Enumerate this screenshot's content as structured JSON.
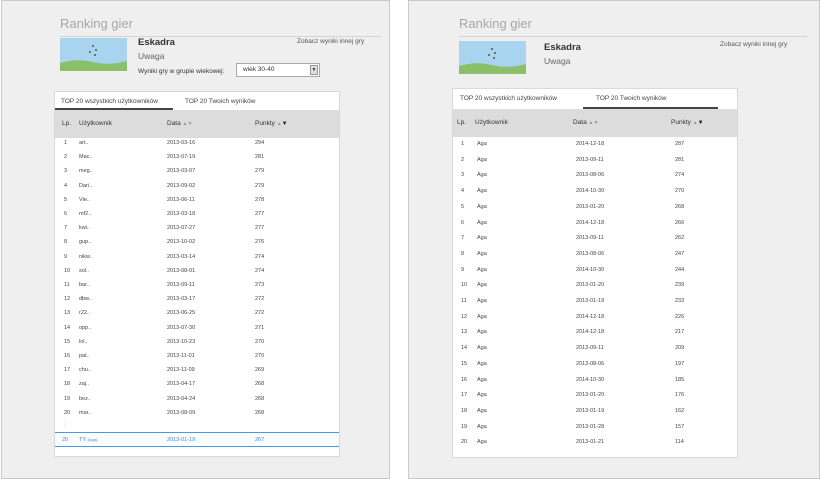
{
  "left": {
    "title": "Ranking gier",
    "game_name": "Eskadra",
    "game_subtitle": "Uwaga",
    "other_results_link": "Zobacz wyniki innej gry",
    "age_label": "Wyniki gry w grupie wiekowej:",
    "age_value": "wiek 30-40",
    "tabs": [
      "TOP 20 wszystkich użytkowników",
      "TOP 20 Twoich wyników"
    ],
    "active_tab": 0,
    "columns": {
      "lp": "Lp.",
      "user": "Użytkownik",
      "date": "Data",
      "points": "Punkty"
    },
    "rows": [
      {
        "lp": "1",
        "user": "art..",
        "date": "2013-03-16",
        "points": "294"
      },
      {
        "lp": "2",
        "user": "Mac..",
        "date": "2013-07-19",
        "points": "281"
      },
      {
        "lp": "3",
        "user": "meg..",
        "date": "2013-03-07",
        "points": "279"
      },
      {
        "lp": "4",
        "user": "Dari..",
        "date": "2013-09-02",
        "points": "279"
      },
      {
        "lp": "5",
        "user": "Vie..",
        "date": "2013-06-11",
        "points": "278"
      },
      {
        "lp": "6",
        "user": "mf2..",
        "date": "2013-03-18",
        "points": "277"
      },
      {
        "lp": "7",
        "user": "kwi..",
        "date": "2013-07-27",
        "points": "277"
      },
      {
        "lp": "8",
        "user": "gup..",
        "date": "2013-10-02",
        "points": "276"
      },
      {
        "lp": "9",
        "user": "nikw..",
        "date": "2013-03-14",
        "points": "274"
      },
      {
        "lp": "10",
        "user": "sol..",
        "date": "2013-08-01",
        "points": "274"
      },
      {
        "lp": "11",
        "user": "bar..",
        "date": "2013-09-11",
        "points": "273"
      },
      {
        "lp": "12",
        "user": "dbw..",
        "date": "2013-03-17",
        "points": "272"
      },
      {
        "lp": "13",
        "user": "r22..",
        "date": "2013-06-25",
        "points": "272"
      },
      {
        "lp": "14",
        "user": "opp..",
        "date": "2013-07-30",
        "points": "271"
      },
      {
        "lp": "15",
        "user": "lol..",
        "date": "2013-10-23",
        "points": "270"
      },
      {
        "lp": "16",
        "user": "pat..",
        "date": "2013-11-01",
        "points": "270"
      },
      {
        "lp": "17",
        "user": "chu..",
        "date": "2013-11-09",
        "points": "269"
      },
      {
        "lp": "18",
        "user": "zaj..",
        "date": "2013-04-17",
        "points": "268"
      },
      {
        "lp": "19",
        "user": "bez..",
        "date": "2013-04-24",
        "points": "268"
      },
      {
        "lp": "20",
        "user": "mar..",
        "date": "2013-08-09",
        "points": "268"
      }
    ],
    "ellipsis": "⋮",
    "user_row": {
      "lp": "20",
      "user": "TY",
      "user_tag": "(Aga)",
      "date": "2013-01-19",
      "points": "267"
    }
  },
  "right": {
    "title": "Ranking gier",
    "game_name": "Eskadra",
    "game_subtitle": "Uwaga",
    "other_results_link": "Zobacz wyniki innej gry",
    "tabs": [
      "TOP 20 wszystkich użytkowników",
      "TOP 20 Twoich wyników"
    ],
    "active_tab": 1,
    "columns": {
      "lp": "Lp.",
      "user": "Użytkownik",
      "date": "Data",
      "points": "Punkty"
    },
    "rows": [
      {
        "lp": "1",
        "user": "Aga",
        "date": "2014-12-18",
        "points": "287"
      },
      {
        "lp": "2",
        "user": "Aga",
        "date": "2013-09-11",
        "points": "281"
      },
      {
        "lp": "3",
        "user": "Aga",
        "date": "2013-08-06",
        "points": "274"
      },
      {
        "lp": "4",
        "user": "Aga",
        "date": "2014-10-30",
        "points": "270"
      },
      {
        "lp": "5",
        "user": "Aga",
        "date": "2013-01-20",
        "points": "268"
      },
      {
        "lp": "6",
        "user": "Aga",
        "date": "2014-12-18",
        "points": "266"
      },
      {
        "lp": "7",
        "user": "Aga",
        "date": "2013-09-11",
        "points": "262"
      },
      {
        "lp": "8",
        "user": "Aga",
        "date": "2013-08-06",
        "points": "247"
      },
      {
        "lp": "9",
        "user": "Aga",
        "date": "2014-10-30",
        "points": "244"
      },
      {
        "lp": "10",
        "user": "Aga",
        "date": "2013-01-20",
        "points": "239"
      },
      {
        "lp": "11",
        "user": "Aga",
        "date": "2013-01-19",
        "points": "233"
      },
      {
        "lp": "12",
        "user": "Aga",
        "date": "2014-12-18",
        "points": "226"
      },
      {
        "lp": "13",
        "user": "Aga",
        "date": "2014-12-18",
        "points": "217"
      },
      {
        "lp": "14",
        "user": "Aga",
        "date": "2013-09-11",
        "points": "209"
      },
      {
        "lp": "15",
        "user": "Aga",
        "date": "2013-08-06",
        "points": "197"
      },
      {
        "lp": "16",
        "user": "Aga",
        "date": "2014-10-30",
        "points": "185"
      },
      {
        "lp": "17",
        "user": "Aga",
        "date": "2013-01-20",
        "points": "176"
      },
      {
        "lp": "18",
        "user": "Aga",
        "date": "2013-01-19",
        "points": "162"
      },
      {
        "lp": "19",
        "user": "Aga",
        "date": "2013-01-28",
        "points": "157"
      },
      {
        "lp": "20",
        "user": "Aga",
        "date": "2013-01-21",
        "points": "114"
      }
    ]
  }
}
